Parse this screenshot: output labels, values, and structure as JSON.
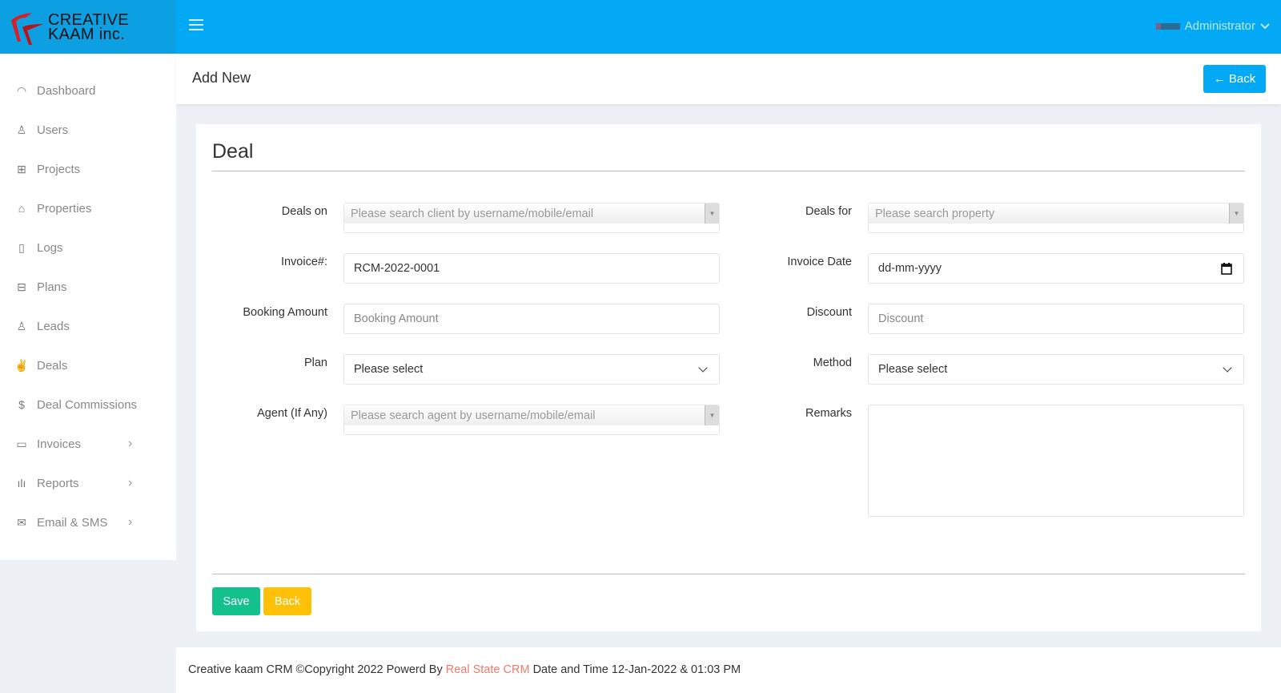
{
  "brand": {
    "line1": "CREATIVE",
    "line2": "KAAM inc."
  },
  "header": {
    "user": "Administrator"
  },
  "page": {
    "title": "Add New",
    "back_label": "Back"
  },
  "sidebar": {
    "items": [
      {
        "label": "Dashboard",
        "icon": "dashboard-icon"
      },
      {
        "label": "Users",
        "icon": "user-icon"
      },
      {
        "label": "Projects",
        "icon": "grid-icon"
      },
      {
        "label": "Properties",
        "icon": "home-icon"
      },
      {
        "label": "Logs",
        "icon": "file-icon"
      },
      {
        "label": "Plans",
        "icon": "briefcase-icon"
      },
      {
        "label": "Leads",
        "icon": "user-icon"
      },
      {
        "label": "Deals",
        "icon": "thumbs-up-icon"
      },
      {
        "label": "Deal Commissions",
        "icon": "dollar-icon"
      },
      {
        "label": "Invoices",
        "icon": "calendar-icon",
        "chevron": "›"
      },
      {
        "label": "Reports",
        "icon": "bar-chart-icon",
        "chevron": "›"
      },
      {
        "label": "Email & SMS",
        "icon": "mail-icon",
        "chevron": "›"
      }
    ]
  },
  "form": {
    "title": "Deal",
    "deals_on": {
      "label": "Deals on",
      "placeholder": "Please search client by username/mobile/email"
    },
    "deals_for": {
      "label": "Deals for",
      "placeholder": "Please search property"
    },
    "invoice_no": {
      "label": "Invoice#:",
      "value": "RCM-2022-0001"
    },
    "invoice_date": {
      "label": "Invoice Date",
      "value": "dd-mm-yyyy"
    },
    "booking_amount": {
      "label": "Booking Amount",
      "placeholder": "Booking Amount"
    },
    "discount": {
      "label": "Discount",
      "placeholder": "Discount"
    },
    "plan": {
      "label": "Plan",
      "value": "Please select"
    },
    "method": {
      "label": "Method",
      "value": "Please select"
    },
    "agent": {
      "label": "Agent (If Any)",
      "placeholder": "Please search agent by username/mobile/email"
    },
    "remarks": {
      "label": "Remarks",
      "value": ""
    },
    "save_label": "Save",
    "back_label": "Back"
  },
  "footer": {
    "prefix": "Creative kaam CRM ©Copyright 2022 Powerd By",
    "link": "Real State CRM",
    "suffix": "Date and Time 12-Jan-2022 & 01:03 PM"
  },
  "colors": {
    "primary": "#03a9f4",
    "save": "#13c18c",
    "back": "#ffc107",
    "link": "#f07a6a"
  }
}
